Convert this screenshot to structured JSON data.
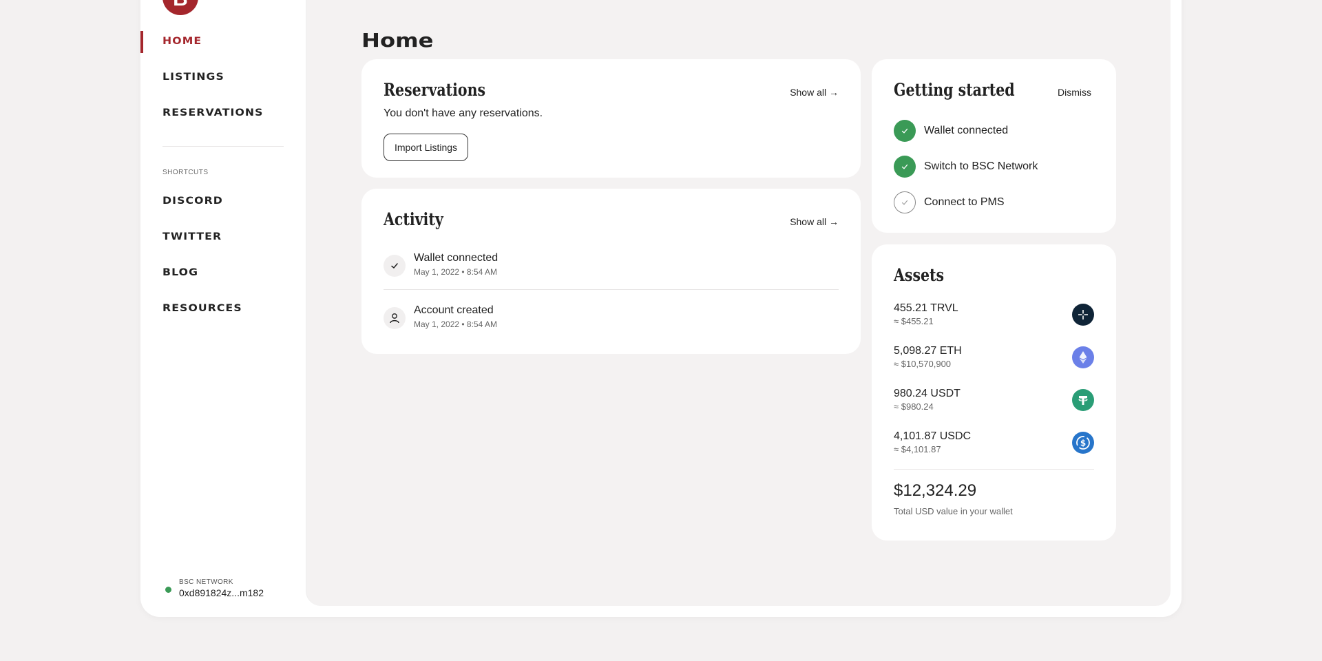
{
  "brand": {
    "logo_letter": "B",
    "accent": "#a4262c"
  },
  "sidebar": {
    "nav": [
      {
        "label": "HOME",
        "active": true
      },
      {
        "label": "LISTINGS",
        "active": false
      },
      {
        "label": "RESERVATIONS",
        "active": false
      }
    ],
    "shortcuts_label": "SHORTCUTS",
    "shortcuts": [
      {
        "label": "DISCORD"
      },
      {
        "label": "TWITTER"
      },
      {
        "label": "BLOG"
      },
      {
        "label": "RESOURCES"
      }
    ],
    "network": {
      "label": "BSC NETWORK",
      "address": "0xd891824z...m182",
      "status_color": "#3a9a56"
    }
  },
  "page": {
    "title": "Home"
  },
  "reservations": {
    "title": "Reservations",
    "show_all": "Show all →",
    "empty_text": "You don't have any reservations.",
    "import_button": "Import Listings"
  },
  "activity": {
    "title": "Activity",
    "show_all": "Show all →",
    "items": [
      {
        "icon": "check-icon",
        "title": "Wallet connected",
        "time": "May 1, 2022 • 8:54 AM"
      },
      {
        "icon": "user-icon",
        "title": "Account created",
        "time": "May 1, 2022 • 8:54 AM"
      }
    ]
  },
  "getting_started": {
    "title": "Getting started",
    "dismiss": "Dismiss",
    "steps": [
      {
        "label": "Wallet connected",
        "done": true
      },
      {
        "label": "Switch to BSC Network",
        "done": true
      },
      {
        "label": "Connect to PMS",
        "done": false
      }
    ]
  },
  "assets": {
    "title": "Assets",
    "items": [
      {
        "amount": "455.21 TRVL",
        "usd": "≈ $455.21",
        "icon": "trvl-token-icon",
        "color": "#0f2437"
      },
      {
        "amount": "5,098.27 ETH",
        "usd": "≈ $10,570,900",
        "icon": "eth-token-icon",
        "color": "#6b80e8"
      },
      {
        "amount": "980.24 USDT",
        "usd": "≈ $980.24",
        "icon": "usdt-token-icon",
        "color": "#2a9d76"
      },
      {
        "amount": "4,101.87 USDC",
        "usd": "≈ $4,101.87",
        "icon": "usdc-token-icon",
        "color": "#2775ca"
      }
    ],
    "total": "$12,324.29",
    "total_label": "Total USD value in your wallet"
  }
}
